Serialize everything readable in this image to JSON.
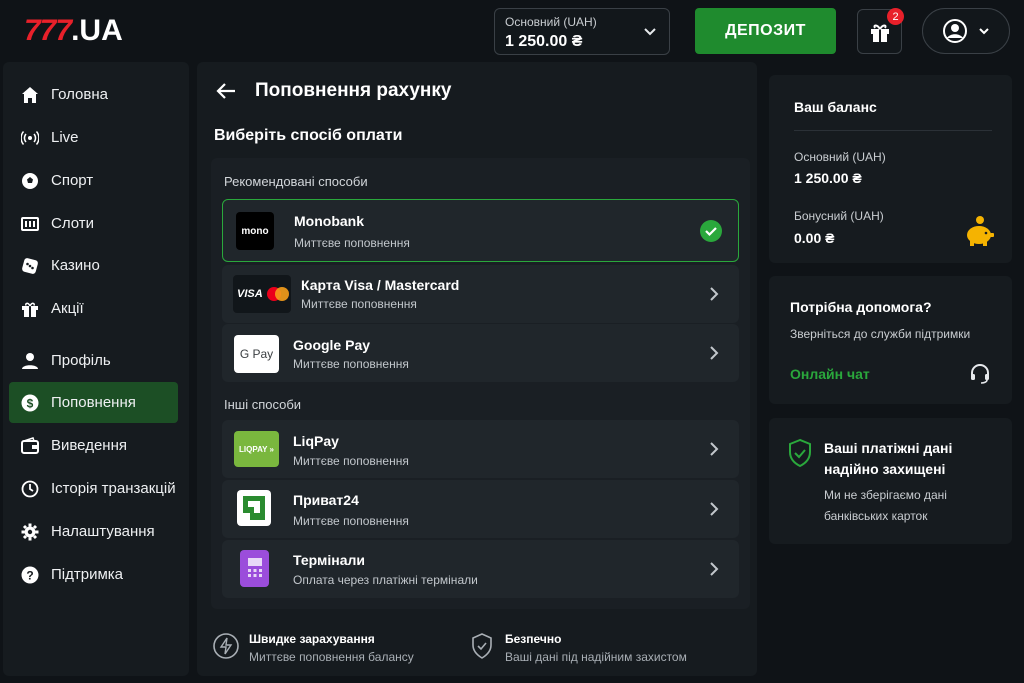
{
  "header": {
    "logo_num": "777",
    "logo_domain": ".UA",
    "balance_label": "Основний (UAH)",
    "balance_value": "1 250.00 ₴",
    "deposit_label": "ДЕПОЗИТ",
    "gift_badge": "2"
  },
  "sidebar": {
    "items": [
      {
        "label": "Головна",
        "icon": "home-icon"
      },
      {
        "label": "Live",
        "icon": "live-broadcast-icon"
      },
      {
        "label": "Спорт",
        "icon": "soccer-ball-icon"
      },
      {
        "label": "Слоти",
        "icon": "slot-machine-icon"
      },
      {
        "label": "Казино",
        "icon": "dice-icon"
      },
      {
        "label": "Акції",
        "icon": "gift-icon"
      },
      {
        "label": "Профіль",
        "icon": "user-icon"
      },
      {
        "label": "Поповнення",
        "icon": "dollar-icon",
        "active": true
      },
      {
        "label": "Виведення",
        "icon": "wallet-icon"
      },
      {
        "label": "Історія транзакцій",
        "icon": "history-icon"
      },
      {
        "label": "Налаштування",
        "icon": "gear-icon"
      },
      {
        "label": "Підтримка",
        "icon": "help-icon"
      }
    ]
  },
  "main": {
    "title": "Поповнення рахунку",
    "subtitle": "Виберіть спосіб оплати",
    "recommended_label": "Рекомендовані способи",
    "other_label": "Інші способи",
    "recommended": [
      {
        "name": "Monobank",
        "desc": "Миттєве поповнення",
        "logo": "mono",
        "selected": true
      },
      {
        "name": "Карта Visa / Mastercard",
        "desc": "Миттєве поповнення",
        "logo": "VISA"
      },
      {
        "name": "Google Pay",
        "desc": "Миттєве поповнення",
        "logo": "G Pay"
      }
    ],
    "other": [
      {
        "name": "LiqPay",
        "desc": "Миттєве поповнення",
        "logo": "LIQPAY »"
      },
      {
        "name": "Приват24",
        "desc": "Миттєве поповнення",
        "logo": ""
      },
      {
        "name": "Термінали",
        "desc": "Оплата через платіжні термінали",
        "logo": ""
      }
    ],
    "features": [
      {
        "title": "Швидке зарахування",
        "desc": "Миттєве поповнення балансу"
      },
      {
        "title": "Безпечно",
        "desc": "Ваші дані під надійним захистом"
      }
    ]
  },
  "right": {
    "balance_title": "Ваш баланс",
    "main_label": "Основний (UAH)",
    "main_value": "1 250.00 ₴",
    "bonus_label": "Бонусний (UAH)",
    "bonus_value": "0.00 ₴",
    "help_title": "Потрібна допомога?",
    "help_desc": "Зверніться до служби підтримки",
    "chat_label": "Онлайн чат",
    "secure_title_1": "Ваші платіжні дані",
    "secure_title_2": "надійно захищені",
    "secure_desc_1": "Ми не зберігаємо дані",
    "secure_desc_2": "банківських карток"
  },
  "colors": {
    "accent": "#1f8b2e",
    "danger": "#e8202a",
    "success": "#2aa83c"
  }
}
